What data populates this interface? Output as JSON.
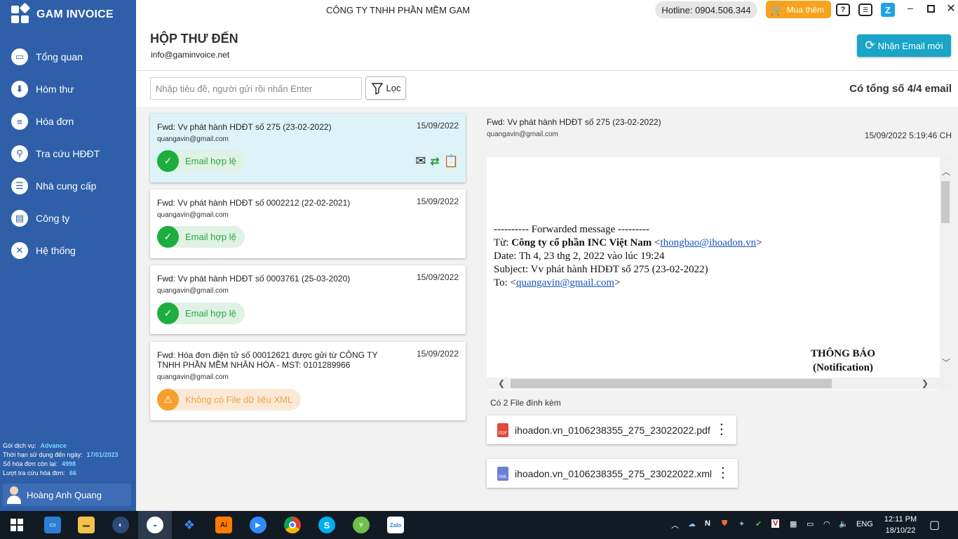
{
  "app": {
    "name": "GAM INVOICE",
    "company": "CÔNG TY TNHH PHẦN MỀM GAM",
    "hotline": "Hotline: 0904.506.344",
    "buy_label": "Mua thêm"
  },
  "sidebar": {
    "items": [
      {
        "label": "Tổng quan",
        "icon": "monitor-icon"
      },
      {
        "label": "Hòm thư",
        "icon": "download-icon"
      },
      {
        "label": "Hóa đơn",
        "icon": "document-icon"
      },
      {
        "label": "Tra cứu HĐĐT",
        "icon": "search-link-icon"
      },
      {
        "label": "Nhà cung cấp",
        "icon": "contacts-icon"
      },
      {
        "label": "Công ty",
        "icon": "building-icon"
      },
      {
        "label": "Hệ thống",
        "icon": "tools-icon"
      }
    ],
    "service": {
      "plan_label": "Gói dịch vụ:",
      "plan_value": "Advance",
      "expiry_label": "Thời hạn sử dụng đến ngày:",
      "expiry_value": "17/01/2023",
      "remaining_label": "Số hóa đơn còn lại:",
      "remaining_value": "4998",
      "lookup_label": "Lượt tra cứu hóa đơn:",
      "lookup_value": "66"
    },
    "user": "Hoàng Anh Quang"
  },
  "header": {
    "title": "HỘP THƯ ĐẾN",
    "email": "info@gaminvoice.net",
    "fetch_label": "Nhận Email mới"
  },
  "toolbar": {
    "search_placeholder": "Nhập tiêu đề, người gửi rồi nhấn Enter",
    "filter_label": "Lọc",
    "total": "Có tổng số 4/4 email"
  },
  "emails": [
    {
      "subject": "Fwd: Vv phát hành HDĐT số 275 (23-02-2022)",
      "sender": "quangavin@gmail.com",
      "date": "15/09/2022",
      "status": "Email hợp lệ",
      "status_type": "ok"
    },
    {
      "subject": "Fwd: Vv phát hành HDĐT số 0002212 (22-02-2021)",
      "sender": "quangavin@gmail.com",
      "date": "15/09/2022",
      "status": "Email hợp lệ",
      "status_type": "ok"
    },
    {
      "subject": "Fwd: Vv phát hành HDĐT số 0003761 (25-03-2020)",
      "sender": "quangavin@gmail.com",
      "date": "15/09/2022",
      "status": "Email hợp lệ",
      "status_type": "ok"
    },
    {
      "subject": "Fwd: Hóa đơn điện tử số 00012621 được gửi từ CÔNG TY TNHH PHẦN MỀM NHÂN HÒA - MST: 0101289966",
      "sender": "quangavin@gmail.com",
      "date": "15/09/2022",
      "status": "Không có File dữ liệu XML",
      "status_type": "warn"
    }
  ],
  "detail": {
    "subject": "Fwd: Vv phát hành HDĐT số 275 (23-02-2022)",
    "sender": "quangavin@gmail.com",
    "datetime": "15/09/2022 5:19:46 CH",
    "body": {
      "line1": "---------- Forwarded message ---------",
      "from_label": "Từ: ",
      "from_name": "Công ty cổ phần INC Việt Nam",
      "from_email": "thongbao@ihoadon.vn",
      "date_line": "Date: Th 4, 23 thg 2, 2022 vào lúc 19:24",
      "subject_line": "Subject: Vv phát hành HDĐT số 275 (23-02-2022)",
      "to_label": "To: ",
      "to_email": "quangavin@gmail.com",
      "notice_title": "THÔNG BÁO",
      "notice_sub": "(Notification)"
    },
    "attachments_title": "Có 2 File đính kèm",
    "attachments": [
      {
        "name": "ihoadon.vn_0106238355_275_23022022.pdf",
        "type": "pdf"
      },
      {
        "name": "ihoadon.vn_0106238355_275_23022022.xml",
        "type": "xml"
      }
    ]
  },
  "taskbar": {
    "lang": "ENG",
    "time": "12:11 PM",
    "date": "18/10/22"
  },
  "colors": {
    "sidebar": "#2e5fa8",
    "accent": "#1aa4c8",
    "ok": "#1eae3f",
    "warn": "#f7a02e",
    "buy": "#f7a31b"
  }
}
